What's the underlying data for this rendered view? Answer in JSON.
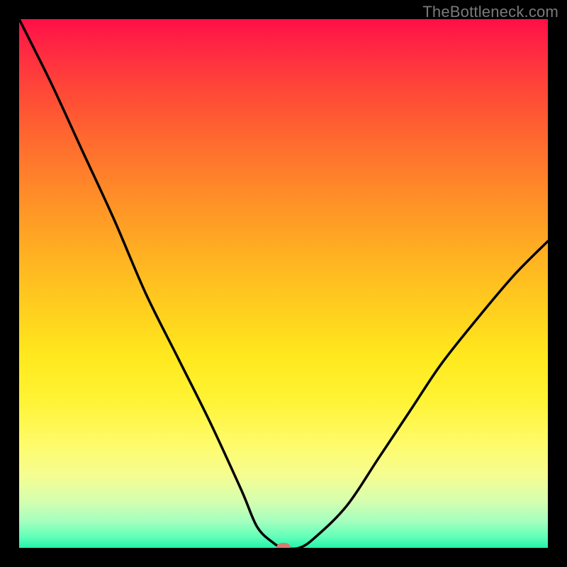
{
  "watermark": "TheBottleneck.com",
  "colors": {
    "frame_background": "#000000",
    "curve_stroke": "#000000",
    "marker_fill": "#d97a6e",
    "watermark_text": "#7a7a7a",
    "gradient_stops": [
      {
        "pos": 0.0,
        "hex": "#ff0f47"
      },
      {
        "pos": 0.06,
        "hex": "#ff2a42"
      },
      {
        "pos": 0.13,
        "hex": "#ff4638"
      },
      {
        "pos": 0.23,
        "hex": "#ff6a2f"
      },
      {
        "pos": 0.33,
        "hex": "#ff8c28"
      },
      {
        "pos": 0.45,
        "hex": "#ffb222"
      },
      {
        "pos": 0.56,
        "hex": "#ffd21e"
      },
      {
        "pos": 0.64,
        "hex": "#ffe91e"
      },
      {
        "pos": 0.72,
        "hex": "#fff334"
      },
      {
        "pos": 0.8,
        "hex": "#fffb68"
      },
      {
        "pos": 0.86,
        "hex": "#f6fd8f"
      },
      {
        "pos": 0.91,
        "hex": "#d7feae"
      },
      {
        "pos": 0.95,
        "hex": "#a4ffbf"
      },
      {
        "pos": 0.98,
        "hex": "#5fffb9"
      },
      {
        "pos": 1.0,
        "hex": "#22f3a8"
      }
    ]
  },
  "chart_data": {
    "type": "line",
    "title": "",
    "xlabel": "",
    "ylabel": "",
    "xlim": [
      0,
      100
    ],
    "ylim": [
      0,
      100
    ],
    "x": [
      0,
      6,
      12,
      18,
      24,
      30,
      36,
      42,
      45,
      48,
      50,
      53,
      56,
      62,
      68,
      74,
      80,
      88,
      94,
      100
    ],
    "y": [
      100,
      88,
      75,
      62,
      48,
      36,
      24,
      11,
      4,
      1,
      0,
      0,
      2,
      8,
      17,
      26,
      35,
      45,
      52,
      58
    ],
    "marker": {
      "x": 50,
      "y": 0
    }
  }
}
